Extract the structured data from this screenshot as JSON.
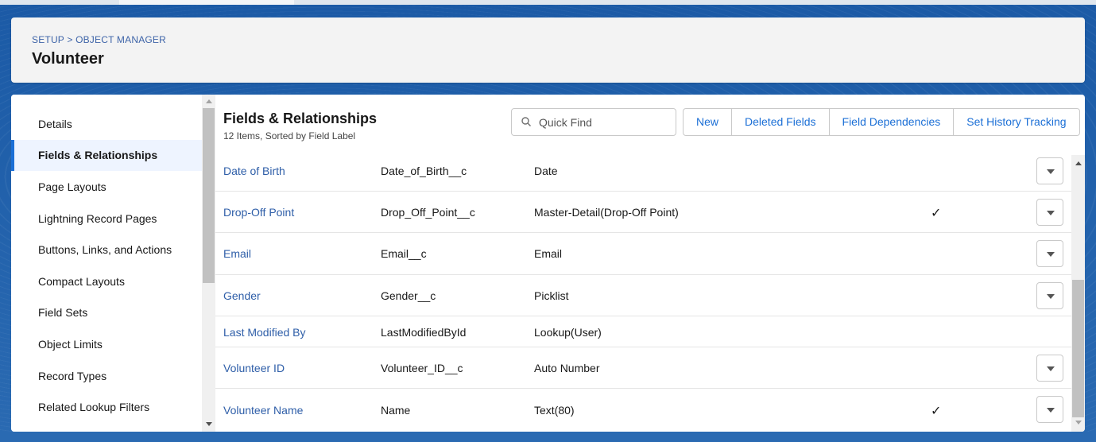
{
  "header": {
    "breadcrumb": "SETUP > OBJECT MANAGER",
    "title": "Volunteer"
  },
  "sidebar": {
    "items": [
      {
        "label": "Details"
      },
      {
        "label": "Fields & Relationships"
      },
      {
        "label": "Page Layouts"
      },
      {
        "label": "Lightning Record Pages"
      },
      {
        "label": "Buttons, Links, and Actions"
      },
      {
        "label": "Compact Layouts"
      },
      {
        "label": "Field Sets"
      },
      {
        "label": "Object Limits"
      },
      {
        "label": "Record Types"
      },
      {
        "label": "Related Lookup Filters"
      }
    ],
    "active": "Fields & Relationships"
  },
  "main": {
    "title": "Fields & Relationships",
    "subtitle": "12 Items, Sorted by Field Label",
    "search": {
      "placeholder": "Quick Find",
      "value": "",
      "icon": "search-icon"
    },
    "buttons": {
      "new": "New",
      "deleted_fields": "Deleted Fields",
      "field_dependencies": "Field Dependencies",
      "set_history_tracking": "Set History Tracking"
    },
    "rows": [
      {
        "label": "Date of Birth",
        "api": "Date_of_Birth__c",
        "type": "Date",
        "indexed": "",
        "menu": true
      },
      {
        "label": "Drop-Off Point",
        "api": "Drop_Off_Point__c",
        "type": "Master-Detail(Drop-Off Point)",
        "indexed": "✓",
        "menu": true
      },
      {
        "label": "Email",
        "api": "Email__c",
        "type": "Email",
        "indexed": "",
        "menu": true
      },
      {
        "label": "Gender",
        "api": "Gender__c",
        "type": "Picklist",
        "indexed": "",
        "menu": true
      },
      {
        "label": "Last Modified By",
        "api": "LastModifiedById",
        "type": "Lookup(User)",
        "indexed": "",
        "menu": false
      },
      {
        "label": "Volunteer ID",
        "api": "Volunteer_ID__c",
        "type": "Auto Number",
        "indexed": "",
        "menu": true
      },
      {
        "label": "Volunteer Name",
        "api": "Name",
        "type": "Text(80)",
        "indexed": "✓",
        "menu": true
      }
    ]
  },
  "colors": {
    "link": "#2e5ea8",
    "accent": "#1b6fd6",
    "background": "#1f5fa8"
  }
}
